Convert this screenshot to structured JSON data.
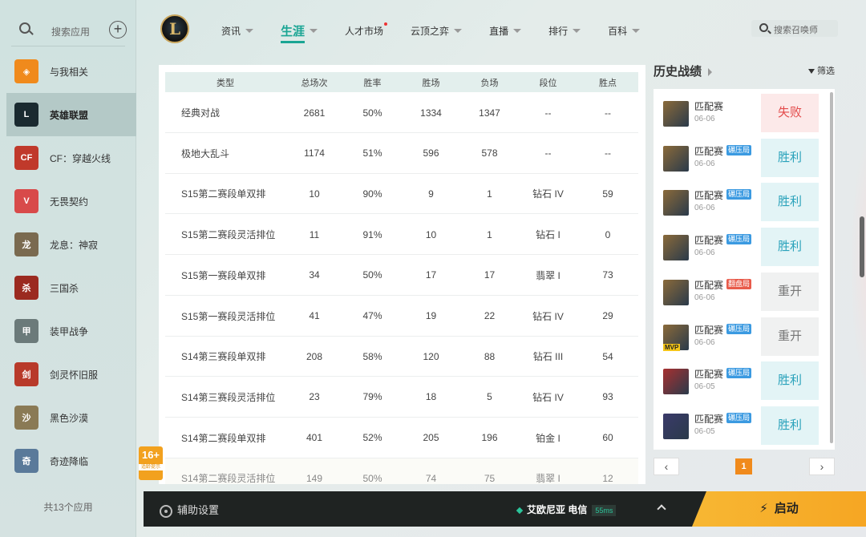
{
  "sidebar": {
    "search_placeholder": "搜索应用",
    "items": [
      {
        "label": "与我相关",
        "icon": "relevance-icon",
        "color": "#f08a1c"
      },
      {
        "label": "英雄联盟",
        "icon": "lol-icon",
        "color": "#1a2a30"
      },
      {
        "label": "CF：穿越火线",
        "icon": "cf-icon",
        "color": "#c0392b"
      },
      {
        "label": "无畏契约",
        "icon": "valorant-icon",
        "color": "#d84a4a"
      },
      {
        "label": "龙息：神寂",
        "icon": "dragon-icon",
        "color": "#7a6a50"
      },
      {
        "label": "三国杀",
        "icon": "sanguosha-icon",
        "color": "#9b2a20"
      },
      {
        "label": "装甲战争",
        "icon": "armored-icon",
        "color": "#6b7a7a"
      },
      {
        "label": "剑灵怀旧服",
        "icon": "bns-icon",
        "color": "#b83a2a"
      },
      {
        "label": "黑色沙漠",
        "icon": "bdo-icon",
        "color": "#8a7a55"
      },
      {
        "label": "奇迹降临",
        "icon": "miracle-icon",
        "color": "#5a7a9a"
      }
    ],
    "count_text": "共13个应用"
  },
  "nav": {
    "items": [
      {
        "label": "资讯",
        "chev": true
      },
      {
        "label": "生涯",
        "chev": true,
        "active": true
      },
      {
        "label": "人才市场",
        "chev": false,
        "dot": true
      },
      {
        "label": "云顶之弈",
        "chev": true
      },
      {
        "label": "直播",
        "chev": true
      },
      {
        "label": "排行",
        "chev": true
      },
      {
        "label": "百科",
        "chev": true
      }
    ],
    "search_placeholder": "搜索召唤师"
  },
  "table": {
    "headers": [
      "类型",
      "总场次",
      "胜率",
      "胜场",
      "负场",
      "段位",
      "胜点"
    ],
    "rows": [
      [
        "经典对战",
        "2681",
        "50%",
        "1334",
        "1347",
        "--",
        "--"
      ],
      [
        "极地大乱斗",
        "1174",
        "51%",
        "596",
        "578",
        "--",
        "--"
      ],
      [
        "S15第二赛段单双排",
        "10",
        "90%",
        "9",
        "1",
        "钻石 IV",
        "59"
      ],
      [
        "S15第二赛段灵活排位",
        "11",
        "91%",
        "10",
        "1",
        "钻石 I",
        "0"
      ],
      [
        "S15第一赛段单双排",
        "34",
        "50%",
        "17",
        "17",
        "翡翠 I",
        "73"
      ],
      [
        "S15第一赛段灵活排位",
        "41",
        "47%",
        "19",
        "22",
        "钻石 IV",
        "29"
      ],
      [
        "S14第三赛段单双排",
        "208",
        "58%",
        "120",
        "88",
        "钻石 III",
        "54"
      ],
      [
        "S14第三赛段灵活排位",
        "23",
        "79%",
        "18",
        "5",
        "钻石 IV",
        "93"
      ],
      [
        "S14第二赛段单双排",
        "401",
        "52%",
        "205",
        "196",
        "铂金 I",
        "60"
      ],
      [
        "S14第二赛段灵活排位",
        "149",
        "50%",
        "74",
        "75",
        "翡翠 I",
        "12"
      ]
    ]
  },
  "history": {
    "title": "历史战绩",
    "filter": "筛选",
    "matches": [
      {
        "type": "匹配赛",
        "date": "06-06",
        "tag": "",
        "tag_color": "",
        "result": "失败",
        "kind": "lose",
        "mvp": false,
        "champ": "#8a6a3a"
      },
      {
        "type": "匹配赛",
        "date": "06-06",
        "tag": "碾压局",
        "tag_color": "blue",
        "result": "胜利",
        "kind": "win",
        "mvp": false,
        "champ": "#8a6a3a"
      },
      {
        "type": "匹配赛",
        "date": "06-06",
        "tag": "碾压局",
        "tag_color": "blue",
        "result": "胜利",
        "kind": "win",
        "mvp": false,
        "champ": "#8a6a3a"
      },
      {
        "type": "匹配赛",
        "date": "06-06",
        "tag": "碾压局",
        "tag_color": "blue",
        "result": "胜利",
        "kind": "win",
        "mvp": false,
        "champ": "#8a6a3a"
      },
      {
        "type": "匹配赛",
        "date": "06-06",
        "tag": "翻盘局",
        "tag_color": "red",
        "result": "重开",
        "kind": "remake",
        "mvp": false,
        "champ": "#8a6a3a"
      },
      {
        "type": "匹配赛",
        "date": "06-06",
        "tag": "碾压局",
        "tag_color": "blue",
        "result": "重开",
        "kind": "remake",
        "mvp": true,
        "mvp_label": "MVP",
        "champ": "#8a6a3a"
      },
      {
        "type": "匹配赛",
        "date": "06-05",
        "tag": "碾压局",
        "tag_color": "blue",
        "result": "胜利",
        "kind": "win",
        "mvp": false,
        "champ": "#a83030"
      },
      {
        "type": "匹配赛",
        "date": "06-05",
        "tag": "碾压局",
        "tag_color": "blue",
        "result": "胜利",
        "kind": "win",
        "mvp": false,
        "champ": "#3a3a6a"
      }
    ],
    "page": "1"
  },
  "age_badge": {
    "number": "16+",
    "sub": "适龄提示"
  },
  "bottom": {
    "assist": "辅助设置",
    "server": "艾欧尼亚 电信",
    "ping": "55ms",
    "launch": "启动"
  }
}
